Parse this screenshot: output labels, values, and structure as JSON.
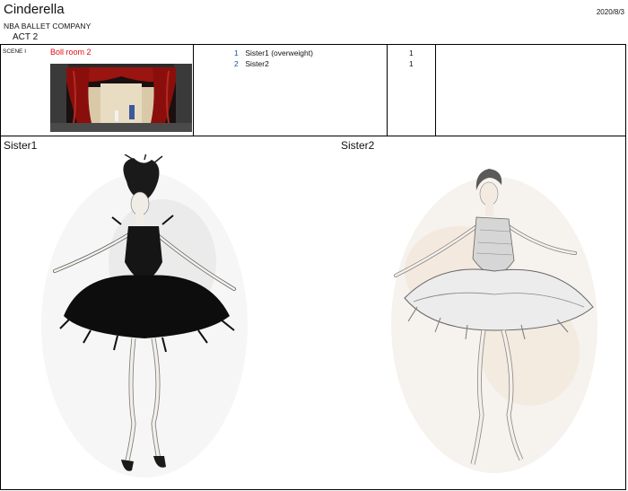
{
  "header": {
    "title": "Cinderella",
    "company": "NBA BALLET COMPANY",
    "act": "ACT 2",
    "date": "2020/8/3"
  },
  "scene": {
    "label": "SCENE I",
    "name": "Boll room 2",
    "cast": [
      {
        "num": "1",
        "name": "Sister1 (overweight)",
        "count": "1"
      },
      {
        "num": "2",
        "name": "Sister2",
        "count": "1"
      }
    ]
  },
  "costumes": {
    "left_label": "Sister1",
    "right_label": "Sister2"
  },
  "colors": {
    "scene_name": "#e01010",
    "cast_number": "#1a4fa0",
    "curtain": "#9a1410"
  }
}
